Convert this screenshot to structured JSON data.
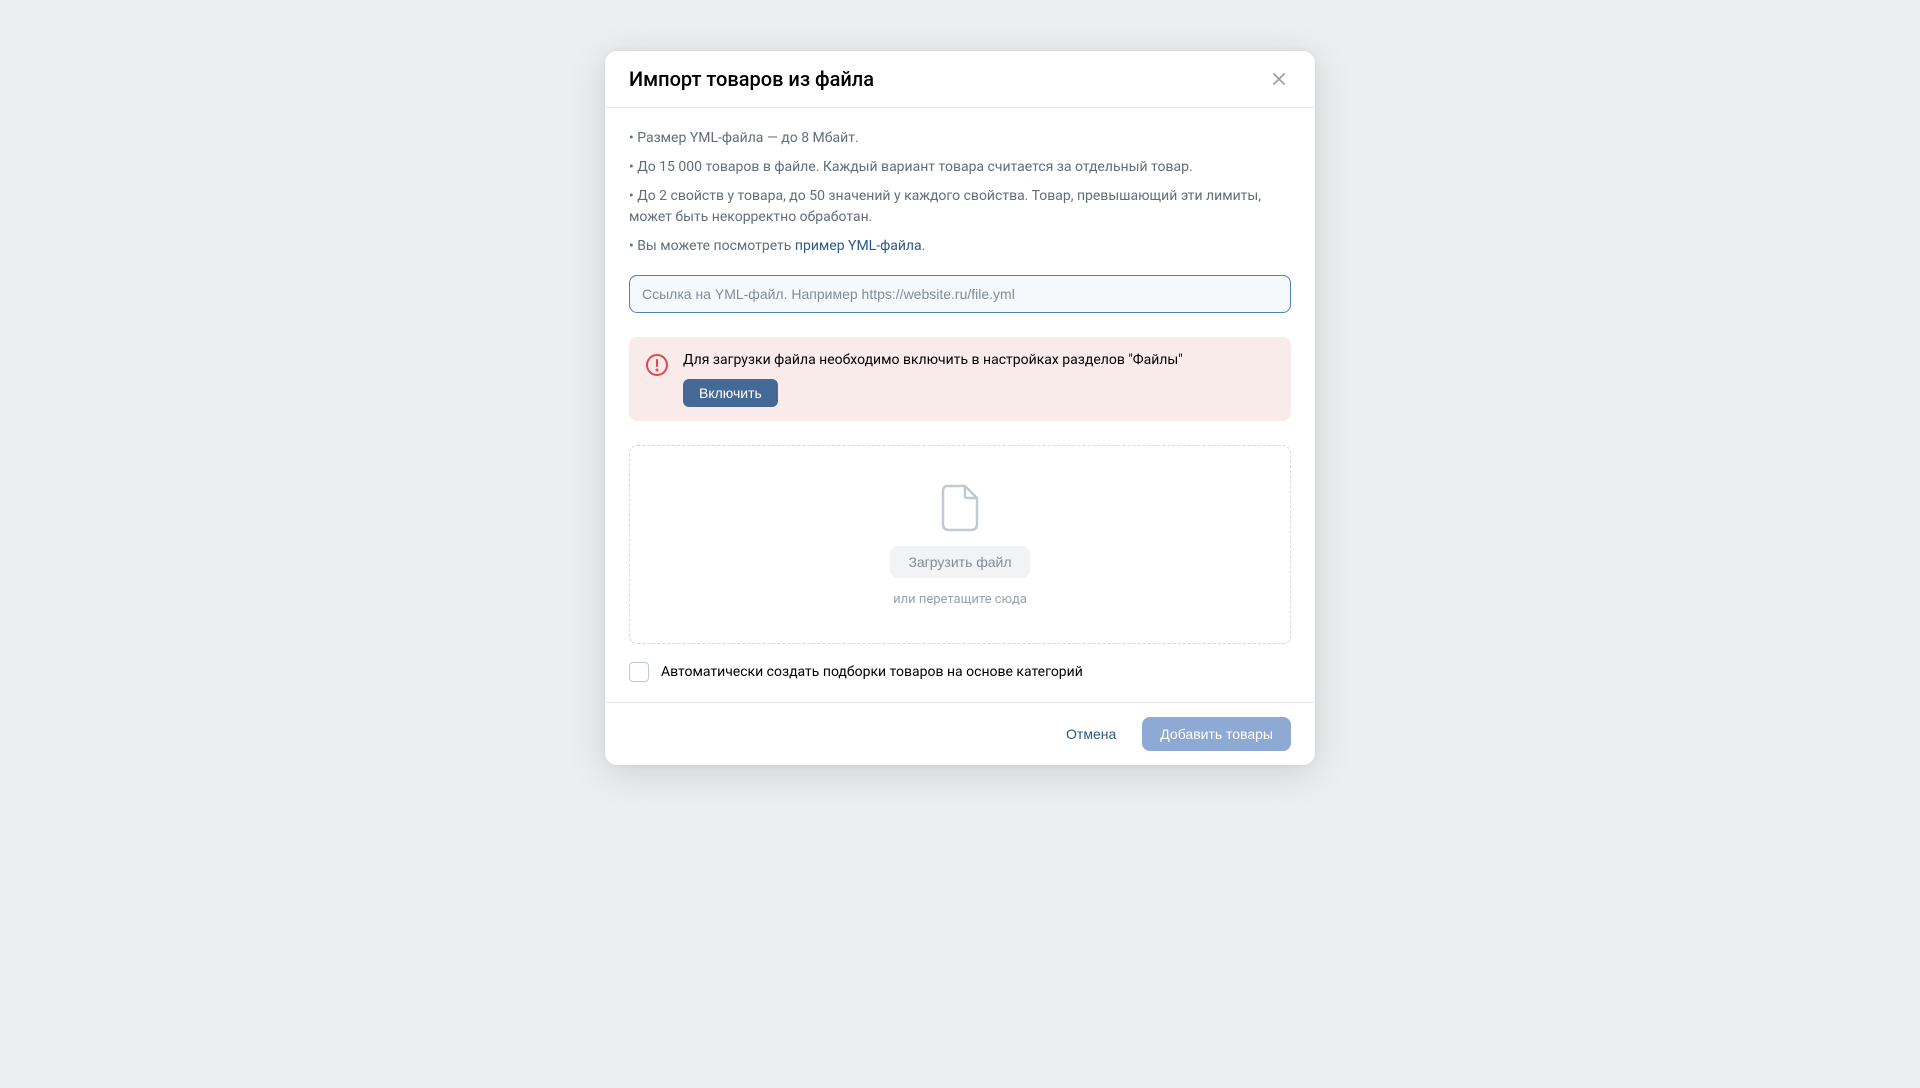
{
  "modal": {
    "title": "Импорт товаров из файла",
    "info": {
      "item1": "• Размер YML-файла — до 8 Мбайт.",
      "item2": "• До 15 000 товаров в файле. Каждый вариант товара считается за отдельный товар.",
      "item3": "• До 2 свойств у товара, до 50 значений у каждого свойства. Товар, превышающий эти лимиты, может быть некорректно обработан.",
      "item4_prefix": "• Вы можете посмотреть ",
      "item4_link": "пример YML-файла",
      "item4_suffix": "."
    },
    "input": {
      "placeholder": "Ссылка на YML-файл. Например https://website.ru/file.yml",
      "value": ""
    },
    "alert": {
      "text": "Для загрузки файла необходимо включить в настройках разделов \"Файлы\"",
      "button": "Включить"
    },
    "dropzone": {
      "upload_button": "Загрузить файл",
      "drag_hint": "или перетащите сюда"
    },
    "checkbox": {
      "label": "Автоматически создать подборки товаров на основе категорий"
    },
    "footer": {
      "cancel": "Отмена",
      "submit": "Добавить товары"
    }
  }
}
